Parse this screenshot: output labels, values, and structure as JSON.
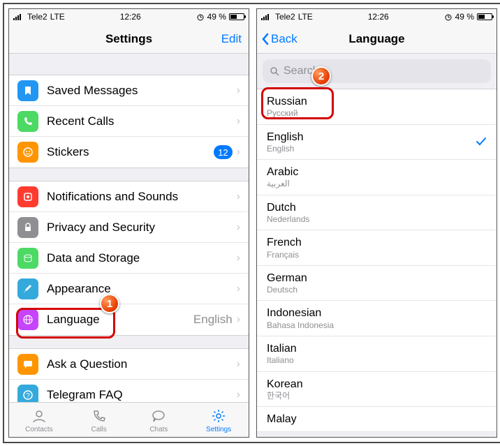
{
  "statusbar": {
    "carrier": "Tele2",
    "network": "LTE",
    "time": "12:26",
    "battery_pct": "49 %"
  },
  "left": {
    "nav_title": "Settings",
    "nav_right": "Edit",
    "group1": [
      {
        "label": "Saved Messages"
      },
      {
        "label": "Recent Calls"
      },
      {
        "label": "Stickers",
        "badge": "12"
      }
    ],
    "group2": [
      {
        "label": "Notifications and Sounds"
      },
      {
        "label": "Privacy and Security"
      },
      {
        "label": "Data and Storage"
      },
      {
        "label": "Appearance"
      },
      {
        "label": "Language",
        "value": "English"
      }
    ],
    "group3": [
      {
        "label": "Ask a Question"
      },
      {
        "label": "Telegram FAQ"
      }
    ],
    "tabs": [
      "Contacts",
      "Calls",
      "Chats",
      "Settings"
    ]
  },
  "right": {
    "back": "Back",
    "nav_title": "Language",
    "search_placeholder": "Search",
    "languages": [
      {
        "name": "Russian",
        "native": "Русский"
      },
      {
        "name": "English",
        "native": "English",
        "selected": true
      },
      {
        "name": "Arabic",
        "native": "العربية"
      },
      {
        "name": "Dutch",
        "native": "Nederlands"
      },
      {
        "name": "French",
        "native": "Français"
      },
      {
        "name": "German",
        "native": "Deutsch"
      },
      {
        "name": "Indonesian",
        "native": "Bahasa Indonesia"
      },
      {
        "name": "Italian",
        "native": "Italiano"
      },
      {
        "name": "Korean",
        "native": "한국어"
      },
      {
        "name": "Malay",
        "native": ""
      }
    ]
  },
  "callouts": {
    "n1": "1",
    "n2": "2"
  }
}
